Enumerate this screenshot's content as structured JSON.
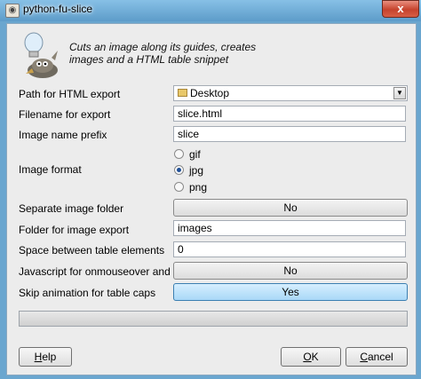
{
  "window": {
    "title": "python-fu-slice",
    "close_glyph": "x"
  },
  "header": {
    "desc_line1": "Cuts an image along its guides, creates",
    "desc_line2": "images and a HTML table snippet",
    "icon": "wilber-lightbulb-icon"
  },
  "form": {
    "path_label": "Path for HTML export",
    "path_value": "Desktop",
    "filename_label": "Filename for export",
    "filename_value": "slice.html",
    "prefix_label": "Image name prefix",
    "prefix_value": "slice",
    "format_label": "Image format",
    "formats": [
      {
        "label": "gif",
        "checked": false
      },
      {
        "label": "jpg",
        "checked": true
      },
      {
        "label": "png",
        "checked": false
      }
    ],
    "separate_label": "Separate image folder",
    "separate_value": "No",
    "folder_label": "Folder for image export",
    "folder_value": "images",
    "space_label": "Space between table elements",
    "space_value": "0",
    "js_label": "Javascript for onmouseover and clicked",
    "js_value": "No",
    "skip_label": "Skip animation for table caps",
    "skip_value": "Yes"
  },
  "progress": {
    "fraction": 0
  },
  "buttons": {
    "help_u": "H",
    "help_rest": "elp",
    "ok_u": "O",
    "ok_rest": "K",
    "cancel_u": "C",
    "cancel_rest": "ancel"
  }
}
